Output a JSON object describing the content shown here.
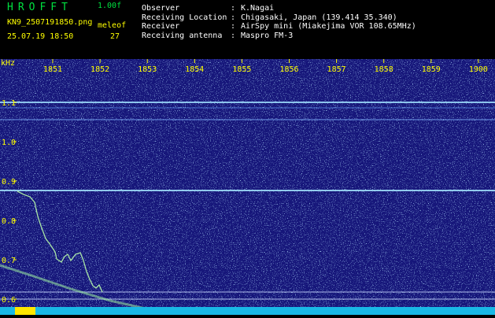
{
  "header": {
    "brand": "HROFFT",
    "version": "1.00f",
    "filename": "KN9_2507191850.png",
    "mode": "meleof",
    "datetime": "25.07.19 18:50",
    "count": "27",
    "info": [
      {
        "key": "Observer",
        "value": "K.Nagai"
      },
      {
        "key": "Receiving Location",
        "value": "Chigasaki, Japan (139.414 35.340)"
      },
      {
        "key": "Receiver",
        "value": "AirSpy mini (Miakejima VOR 108.65MHz)"
      },
      {
        "key": "Receiving antenna",
        "value": "Maspro FM-3"
      }
    ]
  },
  "spectrogram": {
    "freq_unit": "kHz",
    "time_labels": [
      "1851",
      "1852",
      "1853",
      "1854",
      "1855",
      "1856",
      "1857",
      "1858",
      "1859",
      "1900"
    ],
    "freq_labels": [
      "1.1",
      "1.0",
      "0.9",
      "0.8",
      "0.7",
      "0.6"
    ],
    "colors": {
      "background": "#16167a",
      "brand": "#00e040",
      "text": "#ffffff",
      "label": "#ffff00",
      "bottom_band": "#19b8e6",
      "left_marker": "#ffe600",
      "trace": "#a9e6a6"
    }
  }
}
